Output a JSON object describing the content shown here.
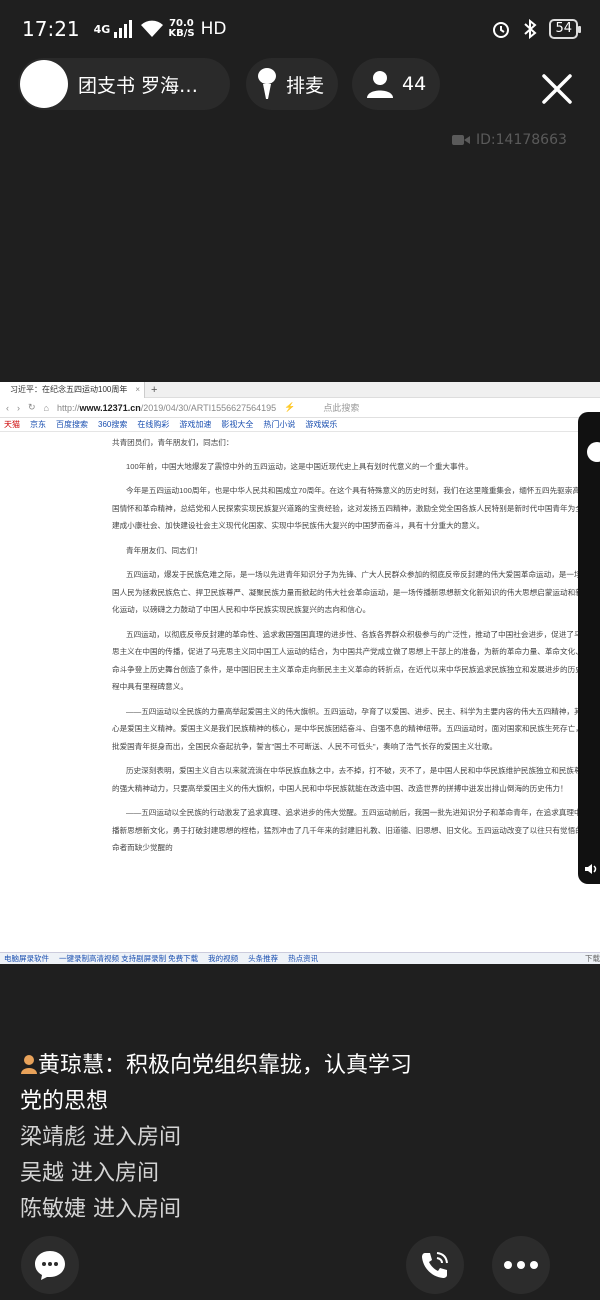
{
  "status_bar": {
    "time": "17:21",
    "network_type": "4G",
    "speed_value": "70.0",
    "speed_unit": "KB/S",
    "hd": "HD",
    "battery": "54"
  },
  "header": {
    "host_name": "团支书 罗海…",
    "mic_queue_label": "排麦",
    "online_count": "44",
    "room_id": "ID:14178663"
  },
  "shared_screen": {
    "tab_title": "习近平：在纪念五四运动100周年",
    "url_prefix": "http://",
    "url_domain": "www.12371.cn",
    "url_path": "/2019/04/30/ARTI1556627564195",
    "search_placeholder": "点此搜索",
    "bookmarks": [
      "天猫",
      "京东",
      "百度搜索",
      "360搜索",
      "在线购彩",
      "游戏加速",
      "影视大全",
      "热门小说",
      "游戏娱乐"
    ],
    "paragraphs": [
      "共青团员们，青年朋友们，同志们：",
      "100年前，中国大地爆发了震惊中外的五四运动，这是中国近现代史上具有划时代意义的一个重大事件。",
      "今年是五四运动100周年，也是中华人民共和国成立70周年。在这个具有特殊意义的历史时刻，我们在这里隆重集会，缅怀五四先驱崇高的爱国情怀和革命精神，总结党和人民探索实现民族复兴道路的宝贵经验，这对发扬五四精神，激励全党全国各族人民特别是新时代中国青年为全面建成小康社会、加快建设社会主义现代化国家、实现中华民族伟大复兴的中国梦而奋斗，具有十分重大的意义。",
      "青年朋友们、同志们！",
      "五四运动，爆发于民族危难之际，是一场以先进青年知识分子为先锋、广大人民群众参加的彻底反帝反封建的伟大爱国革命运动，是一场中国人民为拯救民族危亡、捍卫民族尊严、凝聚民族力量而掀起的伟大社会革命运动，是一场传播新思想新文化新知识的伟大思想启蒙运动和新文化运动，以磅礴之力鼓动了中国人民和中华民族实现民族复兴的志向和信心。",
      "五四运动，以彻底反帝反封建的革命性、追求救国强国真理的进步性、各族各界群众积极参与的广泛性，推动了中国社会进步，促进了马克思主义在中国的传播，促进了马克思主义同中国工人运动的结合，为中国共产党成立做了思想上干部上的准备，为新的革命力量、革命文化、革命斗争登上历史舞台创造了条件，是中国旧民主主义革命走向新民主主义革命的转折点，在近代以来中华民族追求民族独立和发展进步的历史进程中具有里程碑意义。",
      "——五四运动以全民族的力量高举起爱国主义的伟大旗帜。五四运动，孕育了以爱国、进步、民主、科学为主要内容的伟大五四精神，其核心是爱国主义精神。爱国主义是我们民族精神的核心，是中华民族团结奋斗、自强不息的精神纽带。五四运动时，面对国家和民族生死存亡，一批爱国青年挺身而出，全国民众奋起抗争，誓言\"国土不可断送、人民不可低头\"，奏响了浩气长存的爱国主义壮歌。",
      "历史深刻表明，爱国主义自古以来就流淌在中华民族血脉之中，去不掉，打不破，灭不了，是中国人民和中华民族维护民族独立和民族尊严的强大精神动力，只要高举爱国主义的伟大旗帜，中国人民和中华民族就能在改造中国、改造世界的拼搏中迸发出排山倒海的历史伟力！",
      "——五四运动以全民族的行动激发了追求真理、追求进步的伟大觉醒。五四运动前后，我国一批先进知识分子和革命青年，在追求真理中传播新思想新文化，勇于打破封建思想的桎梏，猛烈冲击了几千年来的封建旧礼教、旧道德、旧思想、旧文化。五四运动改变了以往只有觉悟的革命者而缺少觉醒的"
    ],
    "taskbar_items": [
      "电脑屏录软件",
      "一键录制高清视频 支持剧屏录制 免费下载",
      "我的视频",
      "头条推荐",
      "热点资讯"
    ],
    "taskbar_right": "下载"
  },
  "chat": {
    "messages": [
      {
        "user": "黄琼慧",
        "text": "：积极向党组织靠拢，认真学习党的思想"
      }
    ],
    "joins": [
      {
        "user": "梁靖彪",
        "action": " 进入房间"
      },
      {
        "user": "吴越",
        "action": " 进入房间"
      },
      {
        "user": "陈敏婕",
        "action": " 进入房间"
      }
    ]
  },
  "colors": {
    "background": "#1f1f1f",
    "pill": "#2a2a2a",
    "room_id": "#5a5a5a",
    "name_icon": "#e8a25a"
  }
}
